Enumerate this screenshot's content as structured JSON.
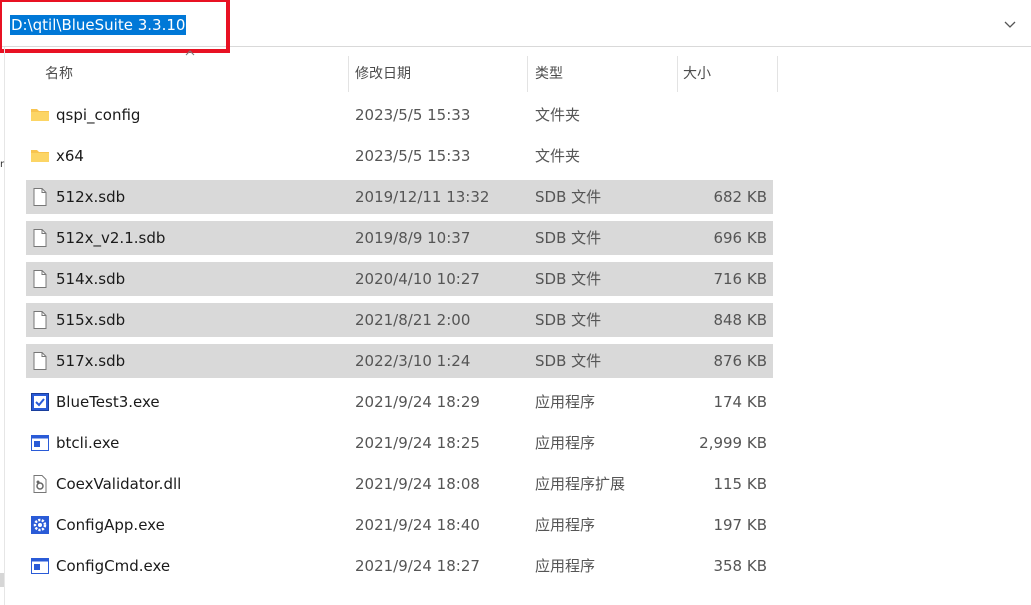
{
  "address_bar": {
    "path": "D:\\qtil\\BlueSuite 3.3.10"
  },
  "columns": {
    "name": "名称",
    "date": "修改日期",
    "type": "类型",
    "size": "大小"
  },
  "files": [
    {
      "name": "qspi_config",
      "date": "2023/5/5 15:33",
      "type": "文件夹",
      "size": "",
      "icon": "folder-icon",
      "selected": false
    },
    {
      "name": "x64",
      "date": "2023/5/5 15:33",
      "type": "文件夹",
      "size": "",
      "icon": "folder-icon",
      "selected": false
    },
    {
      "name": "512x.sdb",
      "date": "2019/12/11 13:32",
      "type": "SDB 文件",
      "size": "682 KB",
      "icon": "file-icon",
      "selected": true
    },
    {
      "name": "512x_v2.1.sdb",
      "date": "2019/8/9 10:37",
      "type": "SDB 文件",
      "size": "696 KB",
      "icon": "file-icon",
      "selected": true
    },
    {
      "name": "514x.sdb",
      "date": "2020/4/10 10:27",
      "type": "SDB 文件",
      "size": "716 KB",
      "icon": "file-icon",
      "selected": true
    },
    {
      "name": "515x.sdb",
      "date": "2021/8/21 2:00",
      "type": "SDB 文件",
      "size": "848 KB",
      "icon": "file-icon",
      "selected": true
    },
    {
      "name": "517x.sdb",
      "date": "2022/3/10 1:24",
      "type": "SDB 文件",
      "size": "876 KB",
      "icon": "file-icon",
      "selected": true
    },
    {
      "name": "BlueTest3.exe",
      "date": "2021/9/24 18:29",
      "type": "应用程序",
      "size": "174 KB",
      "icon": "bluetest-app-icon",
      "selected": false
    },
    {
      "name": "btcli.exe",
      "date": "2021/9/24 18:25",
      "type": "应用程序",
      "size": "2,999 KB",
      "icon": "console-app-icon",
      "selected": false
    },
    {
      "name": "CoexValidator.dll",
      "date": "2021/9/24 18:08",
      "type": "应用程序扩展",
      "size": "115 KB",
      "icon": "dll-file-icon",
      "selected": false
    },
    {
      "name": "ConfigApp.exe",
      "date": "2021/9/24 18:40",
      "type": "应用程序",
      "size": "197 KB",
      "icon": "gear-app-icon",
      "selected": false
    },
    {
      "name": "ConfigCmd.exe",
      "date": "2021/9/24 18:27",
      "type": "应用程序",
      "size": "358 KB",
      "icon": "console-app-icon",
      "selected": false
    }
  ],
  "colors": {
    "selection_bg": "#d9d9d9",
    "highlight_border": "#e81123",
    "text_selection": "#0078d7",
    "folder": "#f8c44f"
  }
}
